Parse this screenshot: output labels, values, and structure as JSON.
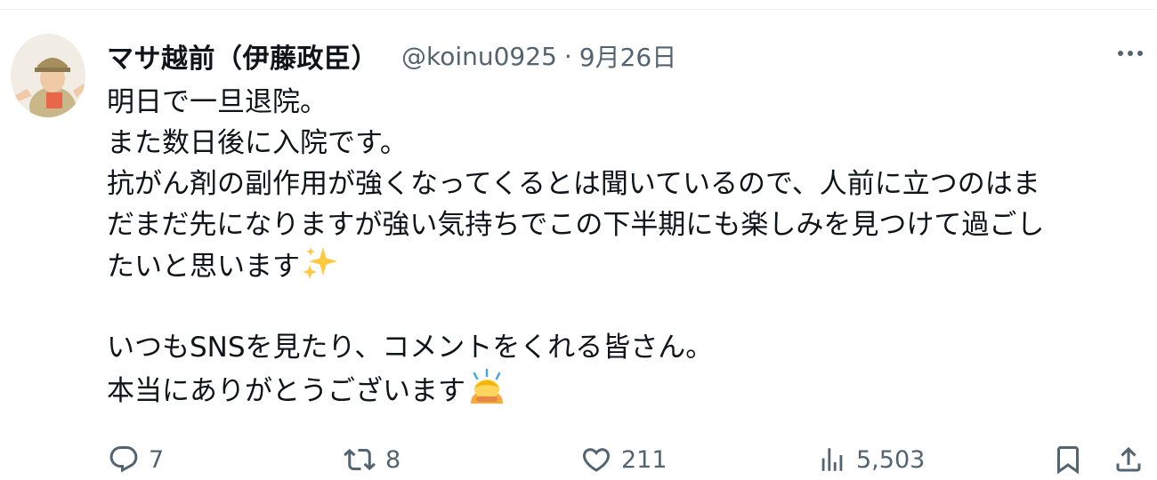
{
  "tweet": {
    "display_name": "マサ越前（伊藤政臣）",
    "handle": "@koinu0925",
    "separator": "·",
    "date": "9月26日",
    "lines": [
      "明日で一旦退院。",
      "また数日後に入院です。",
      "抗がん剤の副作用が強くなってくるとは聞いているので、人前に立つのはま",
      "だまだ先になりますが強い気持ちでこの下半期にも楽しみを見つけて過ごし",
      "たいと思います"
    ],
    "lines2": [
      "いつもSNSを見たり、コメントをくれる皆さん。",
      "本当にありがとうございます"
    ],
    "emojis": [
      "sparkles",
      "person-bowing"
    ]
  },
  "actions": {
    "reply_count": "7",
    "retweet_count": "8",
    "like_count": "211",
    "views_count": "5,503"
  },
  "icons": [
    "more-icon",
    "reply-icon",
    "retweet-icon",
    "like-icon",
    "views-icon",
    "bookmark-icon",
    "share-icon"
  ],
  "colors": {
    "text": "#0f1419",
    "secondary": "#536471",
    "sparkle": "#ffc83d",
    "emoji_person": "#f8a93a"
  }
}
